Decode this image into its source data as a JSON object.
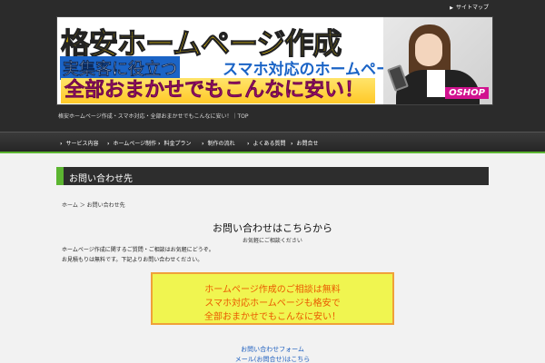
{
  "header": {
    "sitemap_label": "サイトマップ",
    "banner": {
      "title": "格安ホームページ作成",
      "row2a": "実集客に役立つ",
      "row2b": "スマホ対応のホームページ",
      "row3": "全部おまかせでもこんなに安い！",
      "brand": "OSHOP"
    },
    "tagline": "格安ホームページ作成・スマホ対応・全部おまかせでもこんなに安い！｜TOP"
  },
  "nav": {
    "items": [
      "サービス内容",
      "ホームページ制作",
      "料金プラン",
      "制作の流れ",
      "よくある質問",
      "お問合せ"
    ]
  },
  "main": {
    "page_heading": "お問い合わせ先",
    "breadcrumb": "ホーム ＞ お問い合わせ先",
    "sub_title": "お問い合わせはこちらから",
    "sub_sub": "お気軽にご相談ください",
    "paragraphs": [
      "ホームページ作成に関するご質問・ご相談はお気軽にどうぞ。",
      "お見積もりは無料です。下記よりお問い合わせください。"
    ],
    "offer_lines": [
      "ホームページ作成のご相談は無料",
      "スマホ対応ホームページも格安で",
      "全部おまかせでもこんなに安い！"
    ],
    "bottom_links": [
      "お問い合わせフォーム",
      "メール(お問合せ)はこちら"
    ]
  },
  "colors": {
    "accent_green": "#5cb531",
    "header_bg": "#2b2b2b",
    "offer_bg": "#f0f550",
    "offer_border": "#f0a13a",
    "offer_text": "#ea5a00",
    "link_blue": "#1d5fbf"
  }
}
